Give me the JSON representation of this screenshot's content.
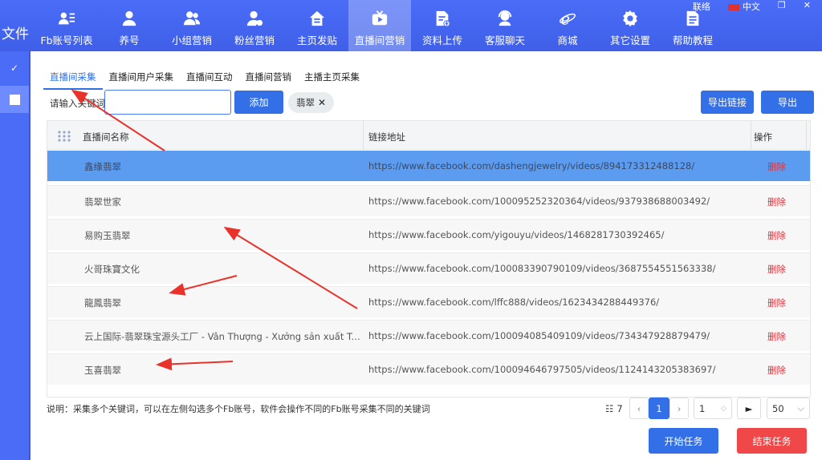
{
  "app": {
    "brand_text": "文件",
    "window_controls": {
      "lang": "中文",
      "left_text": "联络"
    }
  },
  "nav": [
    {
      "label": "Fb账号列表",
      "icon": "account-list-icon"
    },
    {
      "label": "养号",
      "icon": "user-icon"
    },
    {
      "label": "小组营销",
      "icon": "group-icon"
    },
    {
      "label": "粉丝营销",
      "icon": "fans-icon"
    },
    {
      "label": "主页发贴",
      "icon": "home-post-icon"
    },
    {
      "label": "直播间营销",
      "icon": "live-tv-icon",
      "active": true
    },
    {
      "label": "资料上传",
      "icon": "upload-doc-icon"
    },
    {
      "label": "客服聊天",
      "icon": "support-icon"
    },
    {
      "label": "商城",
      "icon": "browser-e-icon"
    },
    {
      "label": "其它设置",
      "icon": "gear-icon"
    },
    {
      "label": "帮助教程",
      "icon": "document-icon"
    }
  ],
  "tabs": [
    "直播间采集",
    "直播间用户采集",
    "直播间互动",
    "直播间营销",
    "主播主页采集"
  ],
  "search": {
    "label": "请输入关键词",
    "value": "",
    "add_label": "添加",
    "chip": "翡翠"
  },
  "toolbar": {
    "export_link_label": "导出链接",
    "export_label": "导出"
  },
  "table": {
    "headers": {
      "name": "直播间名称",
      "url": "链接地址",
      "op": "操作"
    },
    "rows": [
      {
        "name": "鑫缘翡翠",
        "url": "https://www.facebook.com/dashengjewelry/videos/894173312488128/",
        "op": "删除"
      },
      {
        "name": "翡翠世家",
        "url": "https://www.facebook.com/100095252320364/videos/937938688003492/",
        "op": "删除"
      },
      {
        "name": "易购玉翡翠",
        "url": "https://www.facebook.com/yigouyu/videos/1468281730392465/",
        "op": "删除"
      },
      {
        "name": "火哥珠寶文化",
        "url": "https://www.facebook.com/100083390790109/videos/3687554551563338/",
        "op": "删除"
      },
      {
        "name": "龍鳳翡翠",
        "url": "https://www.facebook.com/lffc888/videos/1623434288449376/",
        "op": "删除"
      },
      {
        "name": "云上国际-翡翠珠宝源头工厂 - Vân Thượng - Xưởng sản xuất Trang sức...",
        "url": "https://www.facebook.com/100094085409109/videos/734347928879479/",
        "op": "删除"
      },
      {
        "name": "玉喜翡翠",
        "url": "https://www.facebook.com/100094646797505/videos/1124143205383697/",
        "op": "删除"
      }
    ]
  },
  "footer": {
    "note": "说明：采集多个关键词，可以在左侧勾选多个Fb账号，软件会操作不同的Fb账号采集不同的关键词",
    "total_label": "7",
    "current_page": "1",
    "goto_value": "1",
    "page_size": "50",
    "start_label": "开始任务",
    "stop_label": "结束任务"
  },
  "colors": {
    "accent": "#3370e8",
    "danger": "#f04848",
    "selected_row": "#5b9bf0",
    "topbar": "#4a6cf7"
  }
}
